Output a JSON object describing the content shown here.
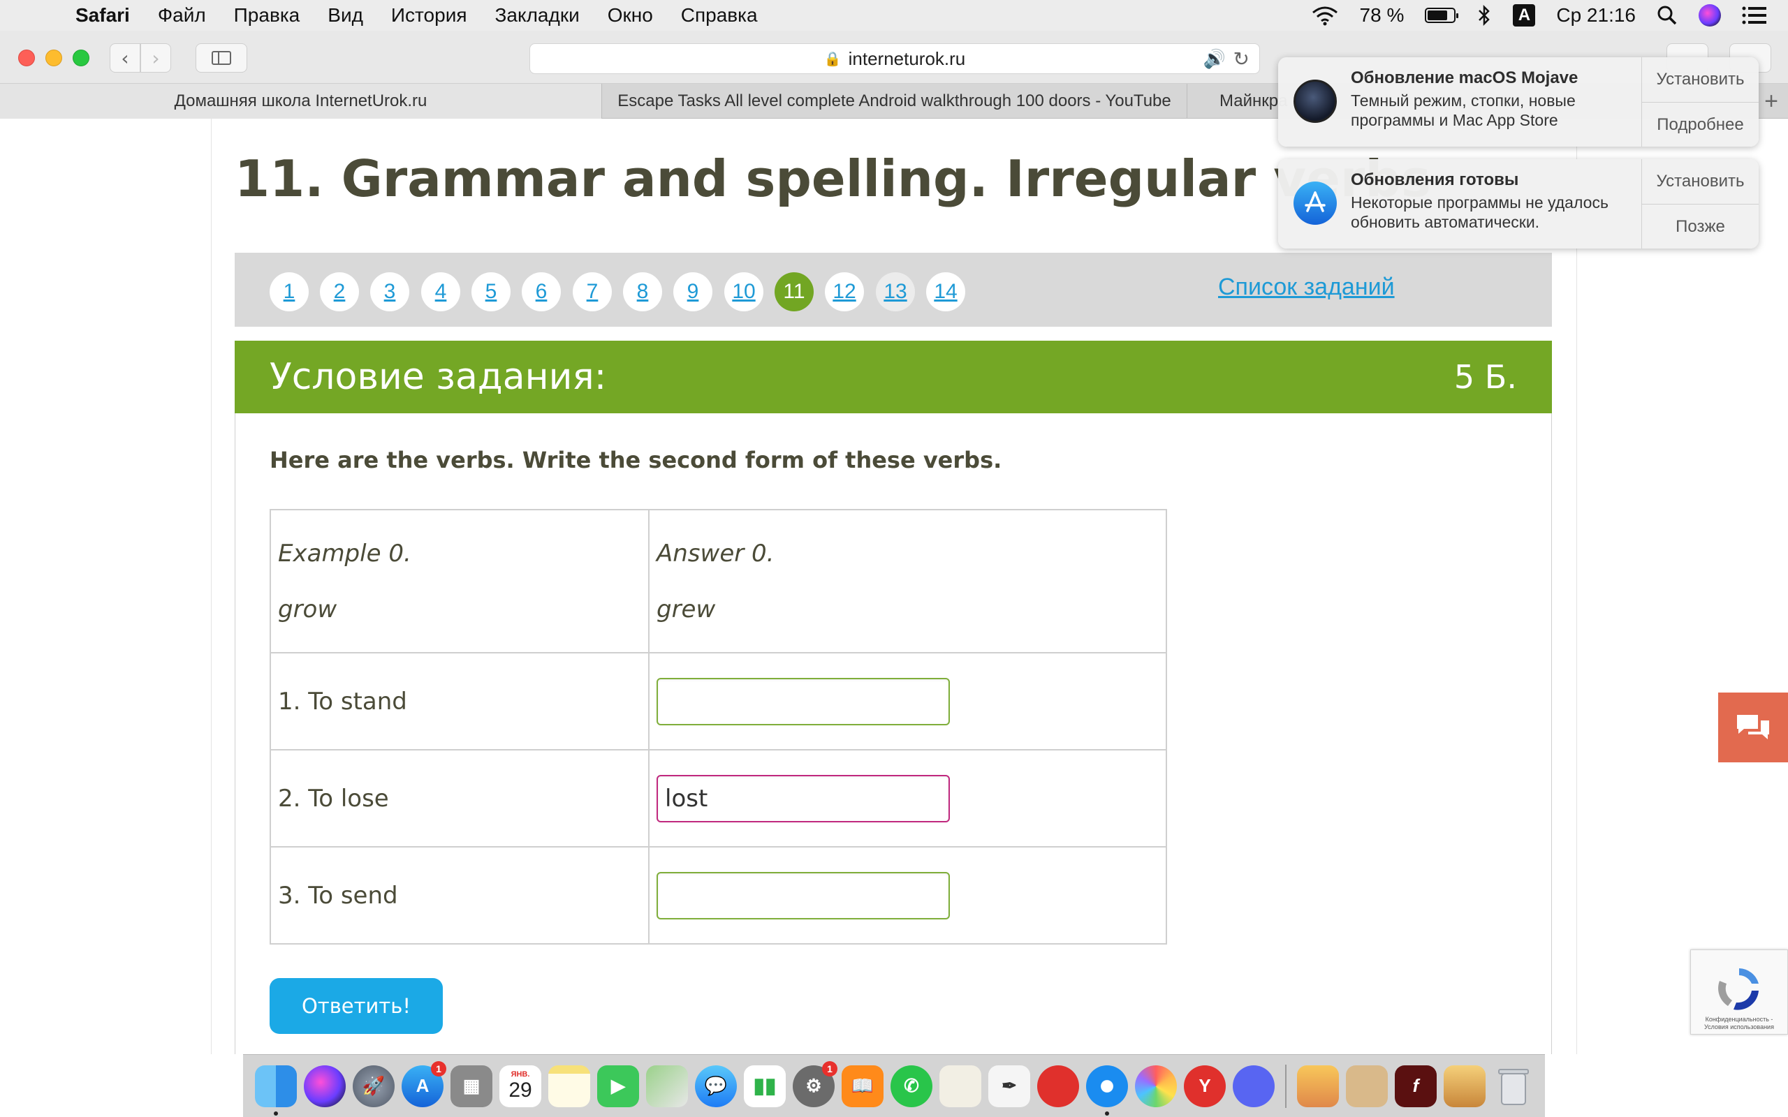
{
  "menubar": {
    "items": [
      "Safari",
      "Файл",
      "Правка",
      "Вид",
      "История",
      "Закладки",
      "Окно",
      "Справка"
    ],
    "battery_percent": "78 %",
    "battery_level": 0.78,
    "keyboard_layout": "A",
    "clock": "Ср 21:16"
  },
  "browser": {
    "url": "interneturok.ru",
    "tabs": [
      "Домашняя школа InternetUrok.ru",
      "Escape Tasks All level complete Android walkthrough 100 doors - YouTube",
      "Майнкра"
    ]
  },
  "page": {
    "title": "11. Grammar and spelling. Irregular verbs",
    "task_numbers": [
      "1",
      "2",
      "3",
      "4",
      "5",
      "6",
      "7",
      "8",
      "9",
      "10",
      "11",
      "12",
      "13",
      "14"
    ],
    "active_task": "11",
    "task_list_link": "Список заданий",
    "condition_title": "Условие задания:",
    "points": "5 Б.",
    "instructions": "Here are the verbs. Write the second form of these verbs.",
    "example": {
      "label": "Example 0.",
      "verb": "grow",
      "answer_label": "Answer 0.",
      "answer": "grew"
    },
    "rows": [
      {
        "verb": "1. To stand",
        "answer": ""
      },
      {
        "verb": "2. To lose",
        "answer": "lost"
      },
      {
        "verb": "3. To send",
        "answer": ""
      }
    ],
    "submit_label": "Ответить!",
    "recaptcha_privacy": "Конфиденциальность - Условия использования"
  },
  "notifications": [
    {
      "title": "Обновление macOS Mojave",
      "body": "Темный режим, стопки, новые программы и Mac App Store",
      "actions": [
        "Установить",
        "Подробнее"
      ]
    },
    {
      "title": "Обновления готовы",
      "body": "Некоторые программы не удалось обновить автоматически.",
      "actions": [
        "Установить",
        "Позже"
      ]
    }
  ],
  "dock": {
    "calendar_month": "ЯНВ.",
    "calendar_day": "29",
    "app_store_badge": "1",
    "sys_prefs_badge": "1"
  },
  "colors": {
    "accent_green": "#74a725",
    "link_blue": "#1e9ad6",
    "button_blue": "#1ba9e6",
    "wrong_border": "#c0287e",
    "chat_orange": "#e26a4f"
  }
}
